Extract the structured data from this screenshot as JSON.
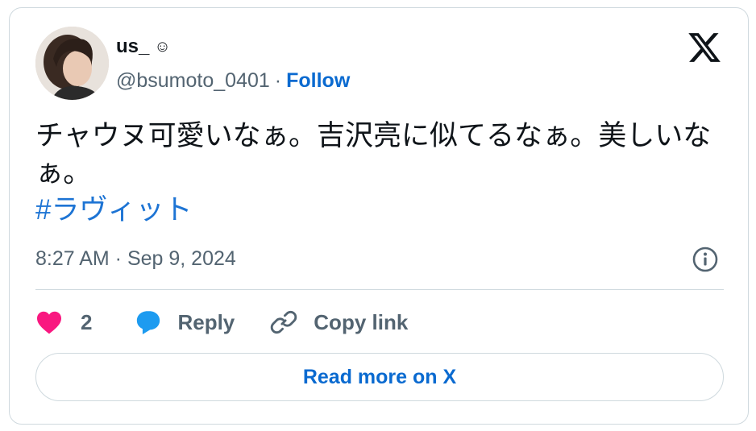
{
  "author": {
    "name": "us_",
    "name_emoji": "☺",
    "handle": "@bsumoto_0401",
    "separator": "·",
    "follow_label": "Follow"
  },
  "tweet": {
    "text": "チャウヌ可愛いなぁ。吉沢亮に似てるなぁ。美しいなぁ。",
    "hashtag": "#ラヴィット",
    "timestamp": "8:27 AM · Sep 9, 2024"
  },
  "actions": {
    "like_count": "2",
    "reply_label": "Reply",
    "copy_link_label": "Copy link"
  },
  "read_more_label": "Read more on X",
  "colors": {
    "link": "#1d74d4",
    "follow": "#0a6ad0",
    "heart": "#f91880",
    "reply_bubble": "#1d9bf0",
    "secondary_text": "#536471",
    "border": "#cfd9de"
  },
  "icons": {
    "logo": "x-logo-icon",
    "like": "heart-icon",
    "reply": "speech-bubble-icon",
    "copy": "link-icon",
    "info": "info-icon"
  }
}
